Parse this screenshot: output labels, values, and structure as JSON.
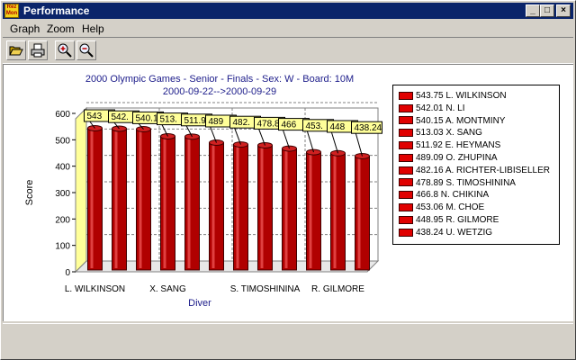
{
  "window": {
    "title": "Performance",
    "icon_text_top": "Rez",
    "icon_text_bottom": "Mon",
    "controls": {
      "minimize": "_",
      "maximize": "□",
      "close": "×"
    }
  },
  "menu": [
    {
      "label": "Graph"
    },
    {
      "label": "Zoom"
    },
    {
      "label": "Help"
    }
  ],
  "toolbar": {
    "buttons": [
      {
        "icon": "open-folder-icon"
      },
      {
        "icon": "print-icon"
      },
      {
        "icon": "zoom-in-icon"
      },
      {
        "icon": "zoom-out-icon"
      }
    ]
  },
  "chart_data": {
    "type": "bar",
    "title": "2000 Olympic Games - Senior - Finals - Sex: W - Board: 10M",
    "subtitle": "2000-09-22-->2000-09-29",
    "xlabel": "Diver",
    "ylabel": "Score",
    "ylim": [
      0,
      600
    ],
    "yticks": [
      0,
      100,
      200,
      300,
      400,
      500,
      600
    ],
    "grid": true,
    "legend_position": "right",
    "bar_color": "#b00000",
    "categories": [
      "L. WILKINSON",
      "N. LI",
      "A. MONTMINY",
      "X. SANG",
      "E. HEYMANS",
      "O. ZHUPINA",
      "A. RICHTER-LIBISELLER",
      "S. TIMOSHININA",
      "N. CHIKINA",
      "M. CHOE",
      "R. GILMORE",
      "U. WETZIG"
    ],
    "values": [
      543.75,
      542.01,
      540.15,
      513.03,
      511.92,
      489.09,
      482.16,
      478.89,
      466.8,
      453.06,
      448.95,
      438.24
    ],
    "data_labels": [
      "543",
      "542.",
      "540.15",
      "513.",
      "511.92",
      "489",
      "482.",
      "478.8",
      "466",
      "453.",
      "448",
      "438.24"
    ],
    "x_tick_labels": [
      {
        "index": 0,
        "label": "L. WILKINSON"
      },
      {
        "index": 3,
        "label": "X. SANG"
      },
      {
        "index": 7,
        "label": "S. TIMOSHININA"
      },
      {
        "index": 10,
        "label": "R. GILMORE"
      }
    ],
    "legend_entries": [
      "543.75 L. WILKINSON",
      "542.01 N. LI",
      "540.15 A. MONTMINY",
      "513.03 X. SANG",
      "511.92 E. HEYMANS",
      "489.09 O. ZHUPINA",
      "482.16 A. RICHTER-LIBISELLER",
      "478.89 S. TIMOSHININA",
      "466.8 N. CHIKINA",
      "453.06 M. CHOE",
      "448.95 R. GILMORE",
      "438.24 U. WETZIG"
    ]
  }
}
